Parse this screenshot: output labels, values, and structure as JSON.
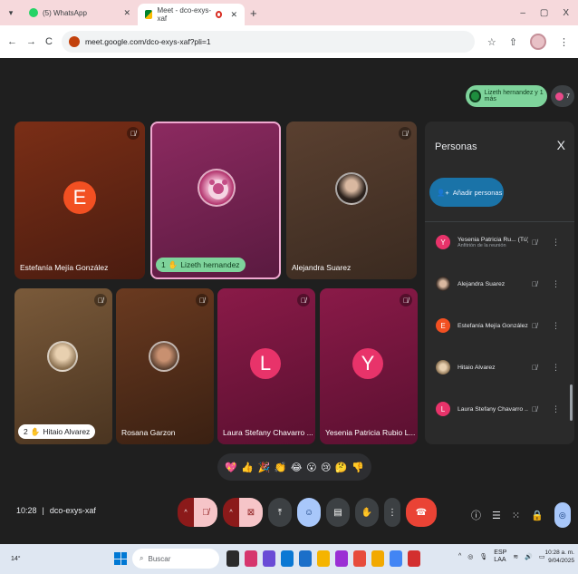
{
  "browser": {
    "tabs": [
      {
        "title": "(5) WhatsApp",
        "active": false
      },
      {
        "title": "Meet - dco-exys-xaf",
        "active": true
      }
    ],
    "url": "meet.google.com/dco-exys-xaf?pli=1",
    "window_controls": [
      "–",
      "▢",
      "X"
    ]
  },
  "meet": {
    "topbar": {
      "presenter_pill": "Lizeth hernandez y 1 más",
      "participants_count": "7"
    },
    "tiles": [
      {
        "name": "Estefanía Mejía González",
        "avatar": "E",
        "color": "#f25022"
      },
      {
        "name": "Lizeth hernandez",
        "badge": "1"
      },
      {
        "name": "Alejandra Suarez"
      },
      {
        "name": "Hitaio Alvarez",
        "badge": "2"
      },
      {
        "name": "Rosana Garzon"
      },
      {
        "name": "Laura Stefany Chavarro ...",
        "avatar": "L",
        "color": "#e8336a"
      },
      {
        "name": "Yesenia Patricia Rubio L...",
        "avatar": "Y",
        "color": "#e8336a"
      }
    ],
    "panel": {
      "title": "Personas",
      "close": "X",
      "add_label": "Añadir personas",
      "people": [
        {
          "name": "Yesenia Patricia Ru... (Tú)",
          "sub": "Anfitrión de la reunión",
          "avatar": "Y",
          "color": "#e8336a"
        },
        {
          "name": "Alejandra Suarez",
          "sub": "",
          "avatar": "",
          "color": "#6b4a3a"
        },
        {
          "name": "Estefanía Mejía González",
          "sub": "",
          "avatar": "E",
          "color": "#f25022"
        },
        {
          "name": "Hitaio Alvarez",
          "sub": "",
          "avatar": "",
          "color": "#c9a88a"
        },
        {
          "name": "Laura Stefany Chavarro ...",
          "sub": "",
          "avatar": "L",
          "color": "#e8336a"
        }
      ]
    },
    "reactions": [
      "💖",
      "👍",
      "🎉",
      "👏",
      "😂",
      "😮",
      "😢",
      "🤔",
      "👎"
    ],
    "bottom": {
      "time": "10:28",
      "separator": "|",
      "meeting_code": "dco-exys-xaf"
    }
  },
  "taskbar": {
    "weather": "14°",
    "search_placeholder": "Buscar",
    "lang": "ESP",
    "lang_sub": "LAA",
    "time": "10:28 a. m.",
    "date": "9/04/2025"
  }
}
